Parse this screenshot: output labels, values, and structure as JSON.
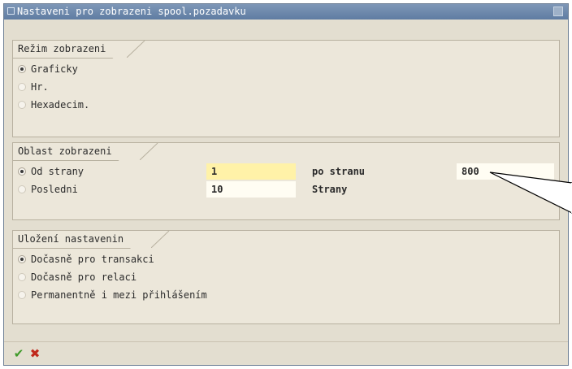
{
  "window": {
    "title": "Nastaveni pro zobrazeni spool.pozadavku"
  },
  "groups": {
    "display_mode": {
      "title": "Režim zobrazeni",
      "options": [
        {
          "label": "Graficky",
          "selected": true
        },
        {
          "label": "Hr.",
          "selected": false
        },
        {
          "label": "Hexadecim.",
          "selected": false
        }
      ]
    },
    "display_area": {
      "title": "Oblast zobrazeni",
      "from_page": {
        "label": "Od strany",
        "selected": true,
        "value": "1",
        "to_label": "po stranu",
        "to_value": "800"
      },
      "last": {
        "label": "Posledni",
        "selected": false,
        "value": "10",
        "unit_label": "Strany"
      }
    },
    "save_settings": {
      "title": "Uložení nastavenin",
      "options": [
        {
          "label": "Dočasně pro transakci",
          "selected": true
        },
        {
          "label": "Dočasně pro relaci",
          "selected": false
        },
        {
          "label": "Permanentně i mezi přihlášením",
          "selected": false
        }
      ]
    }
  },
  "footer": {
    "confirm_icon": "check-icon",
    "cancel_icon": "cancel-x-icon"
  },
  "colors": {
    "titlebar": "#6f89ad",
    "panel": "#ece7da",
    "field_yellow": "#fff2a8",
    "field_white": "#fffdf3",
    "confirm": "#3f9a2a",
    "cancel": "#c0281b"
  }
}
